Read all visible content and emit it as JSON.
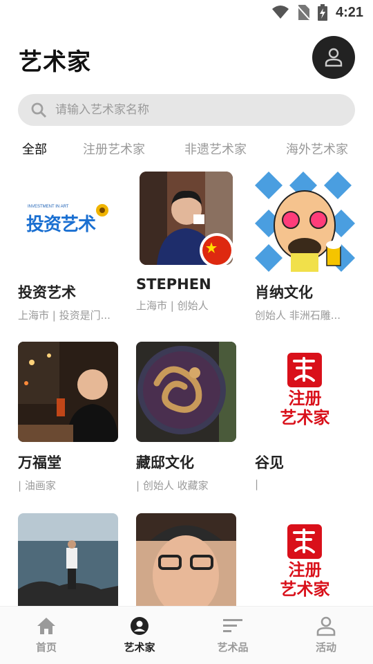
{
  "status": {
    "time": "4:21"
  },
  "header": {
    "title": "艺术家"
  },
  "search": {
    "placeholder": "请输入艺术家名称"
  },
  "tabs": [
    {
      "label": "全部",
      "active": true
    },
    {
      "label": "注册艺术家"
    },
    {
      "label": "非遗艺术家"
    },
    {
      "label": "海外艺术家"
    }
  ],
  "artists": [
    {
      "name": "投资艺术",
      "desc": "上海市 | 投资是门...",
      "logo_sub": "INVESTMENT IN ART",
      "logo_main": "投资艺术"
    },
    {
      "name": "STEPHEN",
      "desc": "上海市 | 创始人"
    },
    {
      "name": "肖纳文化",
      "desc": "创始人 非洲石雕..."
    },
    {
      "name": "万福堂",
      "desc": " | 油画家"
    },
    {
      "name": "藏邸文化",
      "desc": " | 创始人 收藏家"
    },
    {
      "name": "谷见",
      "desc": " | ",
      "logo_line1": "注册",
      "logo_line2": "艺术家"
    },
    {
      "name": "",
      "desc": ""
    },
    {
      "name": "",
      "desc": ""
    },
    {
      "name": "",
      "desc": "",
      "logo_line1": "注册",
      "logo_line2": "艺术家"
    }
  ],
  "nav": [
    {
      "label": "首页"
    },
    {
      "label": "艺术家",
      "active": true
    },
    {
      "label": "艺术品"
    },
    {
      "label": "活动"
    }
  ],
  "colors": {
    "accent": "#222222",
    "inactive": "#999999",
    "brand_red": "#d9101a"
  }
}
